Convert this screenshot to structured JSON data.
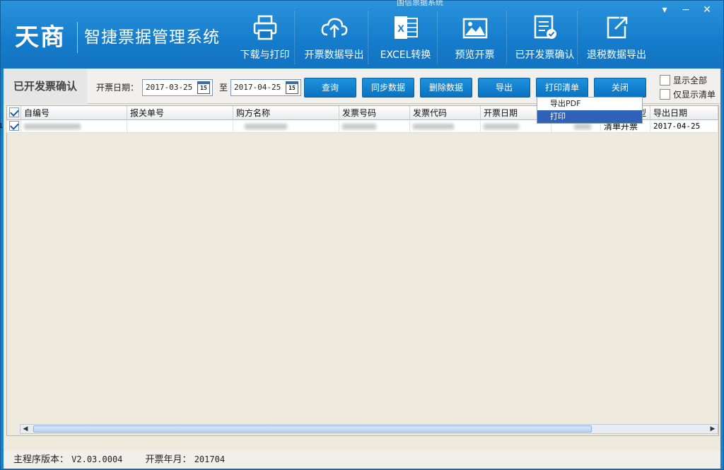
{
  "window": {
    "title": "国信票据系统",
    "minimize": "▾",
    "maximize": "−",
    "close": "✕"
  },
  "header": {
    "brand": "天商",
    "system_title": "智捷票据管理系统"
  },
  "toolbar": [
    {
      "id": "download-print",
      "label": "下载与打印"
    },
    {
      "id": "export-invoice-data",
      "label": "开票数据导出"
    },
    {
      "id": "excel-convert",
      "label": "EXCEL转换"
    },
    {
      "id": "preview-invoice",
      "label": "预览开票"
    },
    {
      "id": "issued-confirm",
      "label": "已开发票确认"
    },
    {
      "id": "tax-refund-export",
      "label": "退税数据导出"
    }
  ],
  "filter": {
    "page_label": "已开发票确认",
    "date_label": "开票日期：",
    "date_from": "2017-03-25",
    "to_label": "至",
    "date_to": "2017-04-25",
    "calendar_day": "15",
    "buttons": {
      "query": "查询",
      "sync": "同步数据",
      "delete": "删除数据",
      "export": "导出",
      "print_list": "打印清单",
      "close": "关闭"
    },
    "show_all": "显示全部",
    "only_list": "仅显示清单"
  },
  "dropdown": {
    "export_pdf": "导出PDF",
    "print": "打印"
  },
  "grid": {
    "columns": [
      "自编号",
      "报关单号",
      "购方名称",
      "发票号码",
      "发票代码",
      "开票日期",
      "",
      "类型",
      "导出日期"
    ],
    "rows": [
      {
        "index": "1",
        "type": "清单开票",
        "export_date": "2017-04-25"
      }
    ]
  },
  "status": {
    "version_label": "主程序版本：",
    "version": "V2.03.0004",
    "month_label": "开票年月：",
    "month": "201704"
  },
  "colors": {
    "accent": "#1c7fc9",
    "button": "#0b72c0",
    "selection": "#3062b8"
  }
}
